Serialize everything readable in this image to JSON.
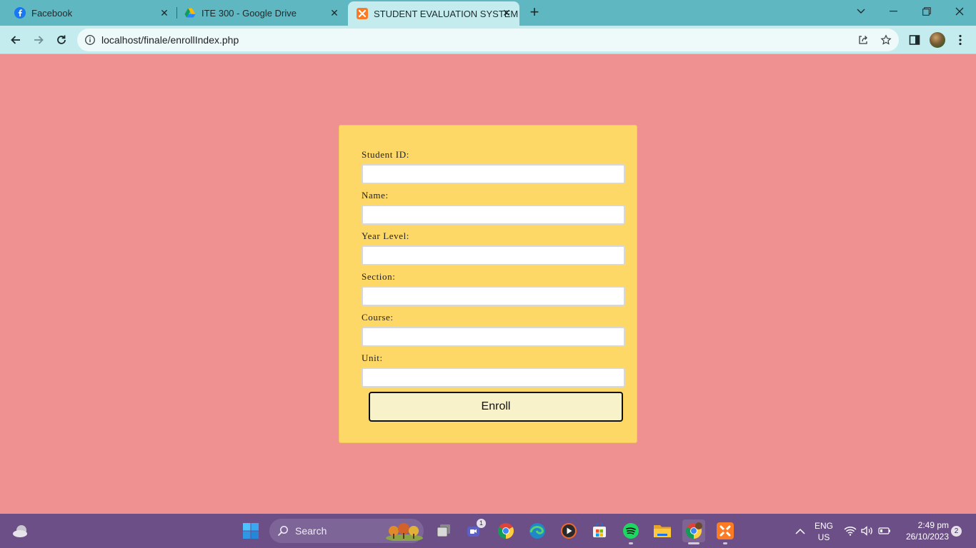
{
  "browser": {
    "tabs": [
      {
        "title": "Facebook",
        "icon": "facebook-icon",
        "active": false
      },
      {
        "title": "ITE 300 - Google Drive",
        "icon": "google-drive-icon",
        "active": false
      },
      {
        "title": "STUDENT EVALUATION SYSTEM",
        "icon": "xampp-icon",
        "active": true
      }
    ],
    "url": "localhost/finale/enrollIndex.php"
  },
  "form": {
    "fields": [
      {
        "label": "Student ID:",
        "value": ""
      },
      {
        "label": "Name:",
        "value": ""
      },
      {
        "label": "Year Level:",
        "value": ""
      },
      {
        "label": "Section:",
        "value": ""
      },
      {
        "label": "Course:",
        "value": ""
      },
      {
        "label": "Unit:",
        "value": ""
      }
    ],
    "submit_label": "Enroll"
  },
  "taskbar": {
    "search_label": "Search",
    "teams_badge": "1",
    "language": "ENG",
    "region": "US",
    "time": "2:49 pm",
    "date": "26/10/2023",
    "notification_count": "2",
    "apps": [
      "start",
      "search",
      "task-view",
      "teams",
      "chrome",
      "edge",
      "media-player",
      "store",
      "spotify",
      "file-explorer",
      "chrome-profile",
      "xampp"
    ]
  },
  "colors": {
    "page_background": "#ee9190",
    "card_background": "#fed866",
    "button_background": "#f8f2cb",
    "tabstrip": "#5fb7c2",
    "toolbar": "#c4ecee",
    "taskbar": "#6c4f87"
  }
}
